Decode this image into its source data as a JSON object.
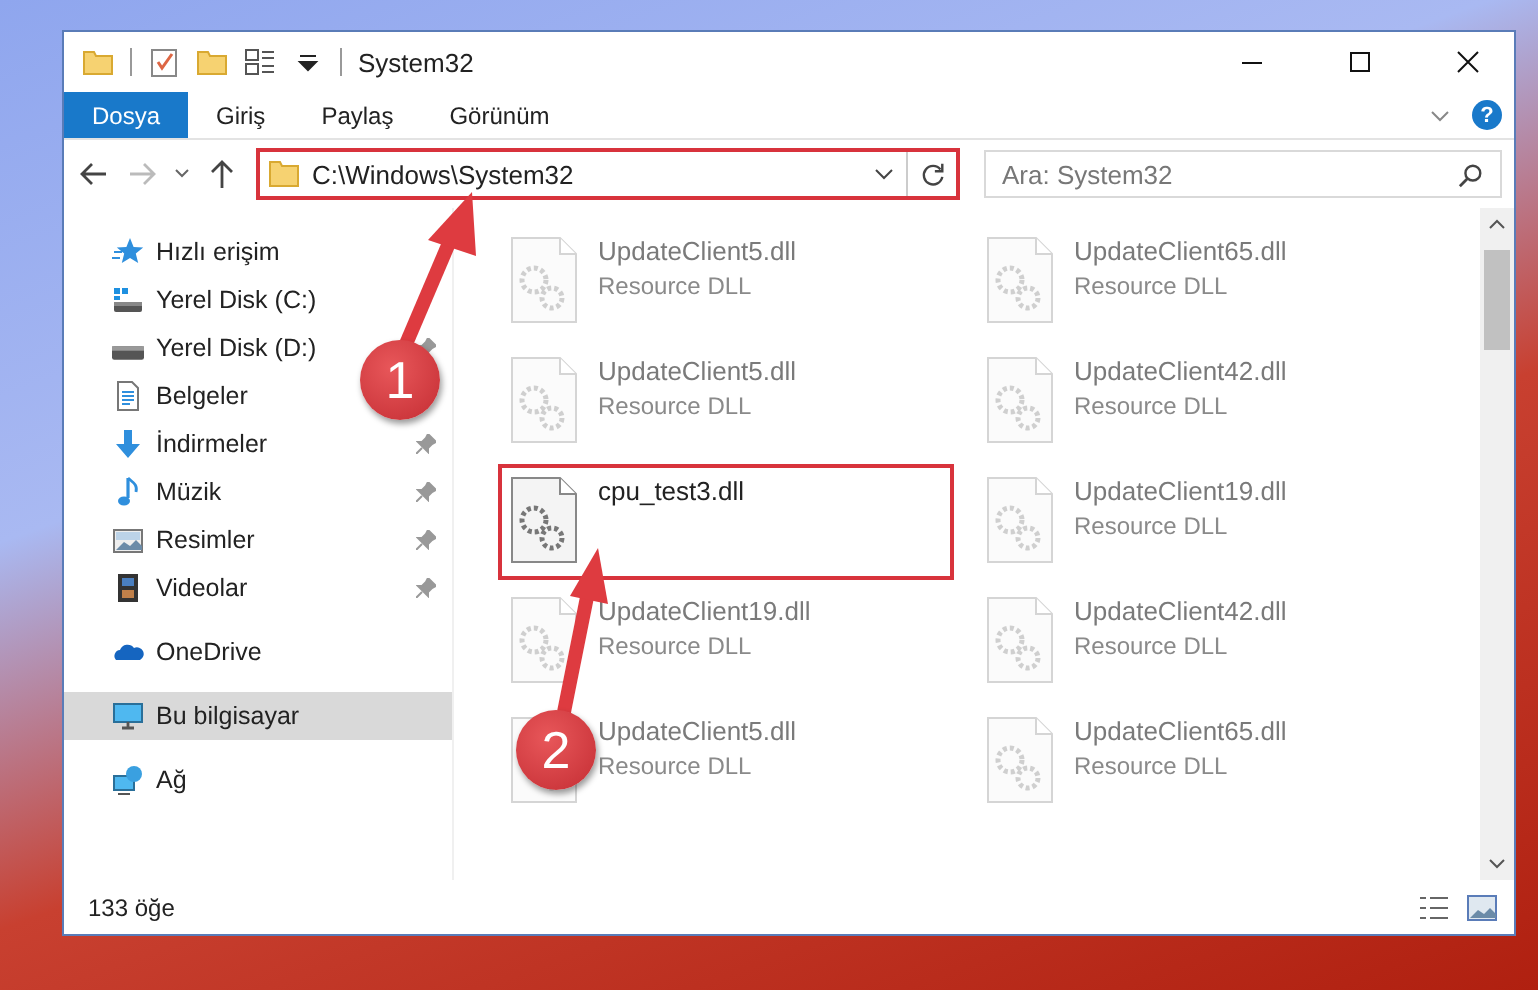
{
  "window": {
    "title": "System32"
  },
  "ribbon": {
    "tabs": [
      {
        "label": "Dosya",
        "selected": true
      },
      {
        "label": "Giriş",
        "selected": false
      },
      {
        "label": "Paylaş",
        "selected": false
      },
      {
        "label": "Görünüm",
        "selected": false
      }
    ],
    "help": "?"
  },
  "address_bar": {
    "path": "C:\\Windows\\System32",
    "highlighted": true
  },
  "search": {
    "placeholder": "Ara: System32"
  },
  "sidebar": {
    "items": [
      {
        "label": "Hızlı erişim",
        "kind": "star",
        "pinned": false,
        "selected": false
      },
      {
        "label": "Yerel Disk (C:)",
        "kind": "system-drive",
        "pinned": false,
        "selected": false
      },
      {
        "label": "Yerel Disk (D:)",
        "kind": "drive",
        "pinned": true,
        "selected": false
      },
      {
        "label": "Belgeler",
        "kind": "documents",
        "pinned": false,
        "selected": false
      },
      {
        "label": "İndirmeler",
        "kind": "download",
        "pinned": true,
        "selected": false
      },
      {
        "label": "Müzik",
        "kind": "music",
        "pinned": true,
        "selected": false
      },
      {
        "label": "Resimler",
        "kind": "pictures",
        "pinned": true,
        "selected": false
      },
      {
        "label": "Videolar",
        "kind": "videos",
        "pinned": true,
        "selected": false
      },
      {
        "label": "OneDrive",
        "kind": "cloud",
        "pinned": false,
        "selected": false
      },
      {
        "label": "Bu bilgisayar",
        "kind": "computer",
        "pinned": false,
        "selected": true
      },
      {
        "label": "Ağ",
        "kind": "network",
        "pinned": false,
        "selected": false
      }
    ]
  },
  "files": [
    {
      "name": "UpdateClient5.dll",
      "type": "Resource DLL",
      "faded": true,
      "highlighted": false
    },
    {
      "name": "UpdateClient65.dll",
      "type": "Resource DLL",
      "faded": true,
      "highlighted": false
    },
    {
      "name": "UpdateClient5.dll",
      "type": "Resource DLL",
      "faded": true,
      "highlighted": false
    },
    {
      "name": "UpdateClient42.dll",
      "type": "Resource DLL",
      "faded": true,
      "highlighted": false
    },
    {
      "name": "cpu_test3.dll",
      "faded": false,
      "highlighted": true
    },
    {
      "name": "UpdateClient19.dll",
      "type": "Resource DLL",
      "faded": true,
      "highlighted": false
    },
    {
      "name": "UpdateClient19.dll",
      "type": "Resource DLL",
      "faded": true,
      "highlighted": false
    },
    {
      "name": "UpdateClient42.dll",
      "type": "Resource DLL",
      "faded": true,
      "highlighted": false
    },
    {
      "name": "UpdateClient5.dll",
      "type": "Resource DLL",
      "faded": true,
      "highlighted": false
    },
    {
      "name": "UpdateClient65.dll",
      "type": "Resource DLL",
      "faded": true,
      "highlighted": false
    }
  ],
  "status_bar": {
    "count": "133 öğe"
  },
  "annotations": [
    {
      "label": "1"
    },
    {
      "label": "2"
    }
  ]
}
